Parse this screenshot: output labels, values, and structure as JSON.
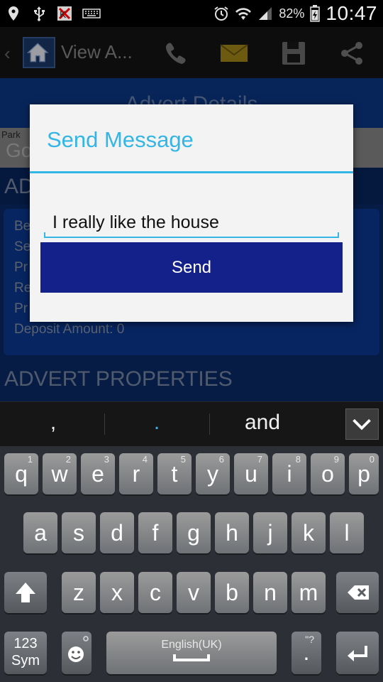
{
  "status_bar": {
    "battery_percent": "82%",
    "time": "10:47",
    "icons": [
      "location-icon",
      "usb-icon",
      "kaspersky-icon",
      "keyboard-icon",
      "alarm-icon",
      "wifi-icon",
      "signal-icon",
      "battery-icon"
    ]
  },
  "action_bar": {
    "title": "View A...",
    "icons": [
      "back-icon",
      "home-icon",
      "phone-icon",
      "mail-icon",
      "save-icon",
      "share-icon"
    ]
  },
  "background_page": {
    "banner_title": "Advert Details",
    "map_label": "Park",
    "map_watermark": "Go",
    "section1_title": "AD",
    "card_rows": [
      "Be",
      "Se",
      "Pr",
      "Re",
      "Pr",
      "Deposit Amount: 0"
    ],
    "section2_title": "ADVERT PROPERTIES"
  },
  "dialog": {
    "title": "Send Message",
    "input_value": "I really like the house",
    "send_label": "Send"
  },
  "suggestions": {
    "items": [
      ",",
      ".",
      "and"
    ],
    "accent_color": "#33b5e5"
  },
  "keyboard": {
    "row1": [
      {
        "key": "q",
        "hint": "1"
      },
      {
        "key": "w",
        "hint": "2"
      },
      {
        "key": "e",
        "hint": "3"
      },
      {
        "key": "r",
        "hint": "4"
      },
      {
        "key": "t",
        "hint": "5"
      },
      {
        "key": "y",
        "hint": "6"
      },
      {
        "key": "u",
        "hint": "7"
      },
      {
        "key": "i",
        "hint": "8"
      },
      {
        "key": "o",
        "hint": "9"
      },
      {
        "key": "p",
        "hint": "0"
      }
    ],
    "row2": [
      "a",
      "s",
      "d",
      "f",
      "g",
      "h",
      "j",
      "k",
      "l"
    ],
    "row3": [
      "z",
      "x",
      "c",
      "v",
      "b",
      "n",
      "m"
    ],
    "sym_label_top": "123",
    "sym_label_bottom": "Sym",
    "space_label": "English(UK)",
    "period_label": ".",
    "period_hint": "\"?",
    "colors": {
      "key_top": "#9b9b9b",
      "key_bottom": "#6f7276",
      "background": "#2c3036"
    }
  }
}
